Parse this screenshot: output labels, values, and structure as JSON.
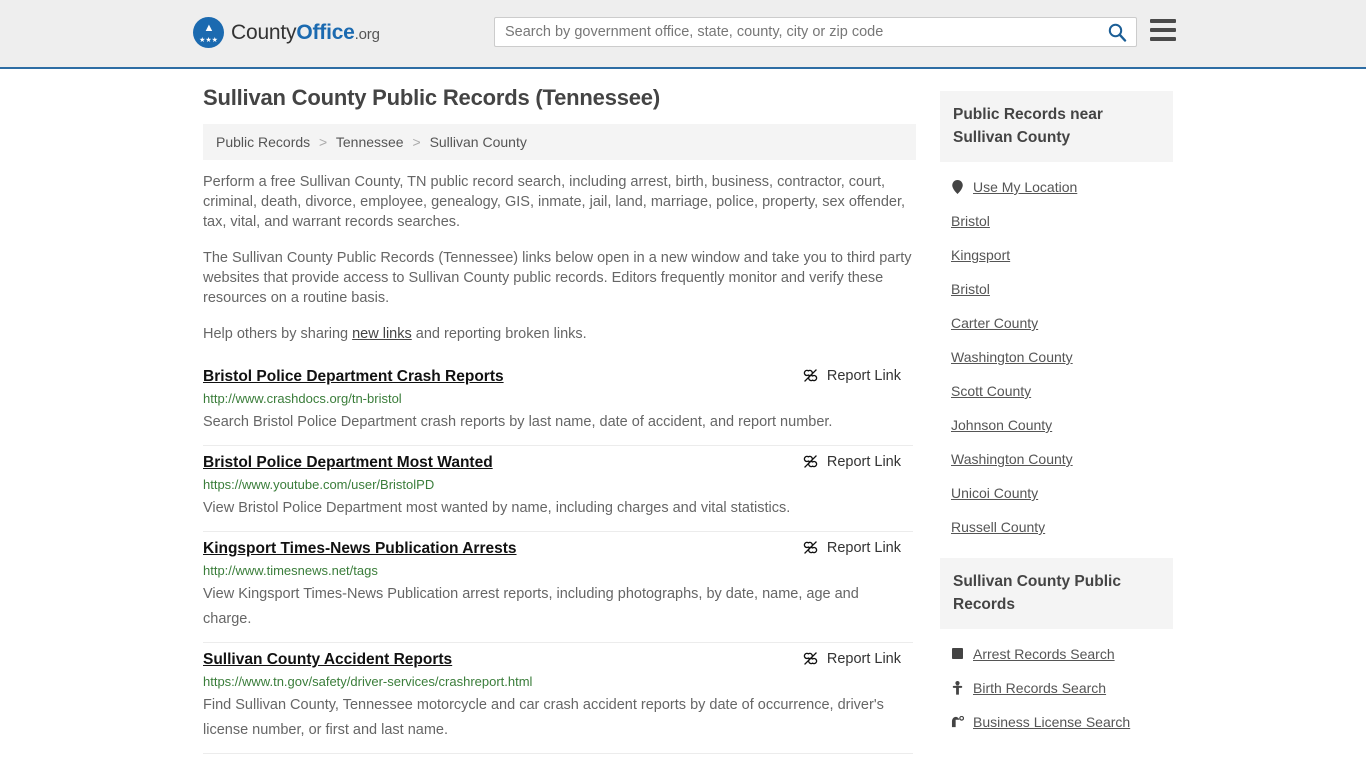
{
  "header": {
    "brand": {
      "part1": "County",
      "part2": "Office",
      "part3": ".org"
    },
    "search": {
      "placeholder": "Search by government office, state, county, city or zip code",
      "value": "",
      "icon": "search-icon"
    },
    "menu_icon": "hamburger-menu-icon",
    "accent_color": "#2e6da4",
    "background_color": "#eeeeee"
  },
  "main": {
    "page_title": "Sullivan County Public Records (Tennessee)",
    "breadcrumb": [
      "Public Records",
      "Tennessee",
      "Sullivan County"
    ],
    "breadcrumb_separator": ">",
    "paragraphs": {
      "p1": "Perform a free Sullivan County, TN public record search, including arrest, birth, business, contractor, court, criminal, death, divorce, employee, genealogy, GIS, inmate, jail, land, marriage, police, property, sex offender, tax, vital, and warrant records searches.",
      "p2": "The Sullivan County Public Records (Tennessee) links below open in a new window and take you to third party websites that provide access to Sullivan County public records. Editors frequently monitor and verify these resources on a routine basis.",
      "p3_before": "Help others by sharing ",
      "p3_link": "new links",
      "p3_after": " and reporting broken links."
    },
    "report_link_label": "Report Link",
    "report_link_icon": "broken-link-icon",
    "links": [
      {
        "title": "Bristol Police Department Crash Reports",
        "url": "http://www.crashdocs.org/tn-bristol",
        "description": "Search Bristol Police Department crash reports by last name, date of accident, and report number."
      },
      {
        "title": "Bristol Police Department Most Wanted",
        "url": "https://www.youtube.com/user/BristolPD",
        "description": "View Bristol Police Department most wanted by name, including charges and vital statistics."
      },
      {
        "title": "Kingsport Times-News Publication Arrests",
        "url": "http://www.timesnews.net/tags",
        "description": "View Kingsport Times-News Publication arrest reports, including photographs, by date, name, age and charge."
      },
      {
        "title": "Sullivan County Accident Reports",
        "url": "https://www.tn.gov/safety/driver-services/crashreport.html",
        "description": "Find Sullivan County, Tennessee motorcycle and car crash accident reports by date of occurrence, driver's license number, or first and last name."
      }
    ]
  },
  "sidebar": {
    "nearby": {
      "title": "Public Records near Sullivan County",
      "items": [
        {
          "label": "Use My Location",
          "icon": "map-pin-icon"
        },
        {
          "label": "Bristol",
          "icon": ""
        },
        {
          "label": "Kingsport",
          "icon": ""
        },
        {
          "label": "Bristol",
          "icon": ""
        },
        {
          "label": "Carter County",
          "icon": ""
        },
        {
          "label": "Washington County",
          "icon": ""
        },
        {
          "label": "Scott County",
          "icon": ""
        },
        {
          "label": "Johnson County",
          "icon": ""
        },
        {
          "label": "Washington County",
          "icon": ""
        },
        {
          "label": "Unicoi County",
          "icon": ""
        },
        {
          "label": "Russell County",
          "icon": ""
        }
      ]
    },
    "records": {
      "title": "Sullivan County Public Records",
      "items": [
        {
          "label": "Arrest Records Search",
          "icon": "fingerprint-icon"
        },
        {
          "label": "Birth Records Search",
          "icon": "baby-icon"
        },
        {
          "label": "Business License Search",
          "icon": "shop-icon"
        }
      ]
    }
  }
}
